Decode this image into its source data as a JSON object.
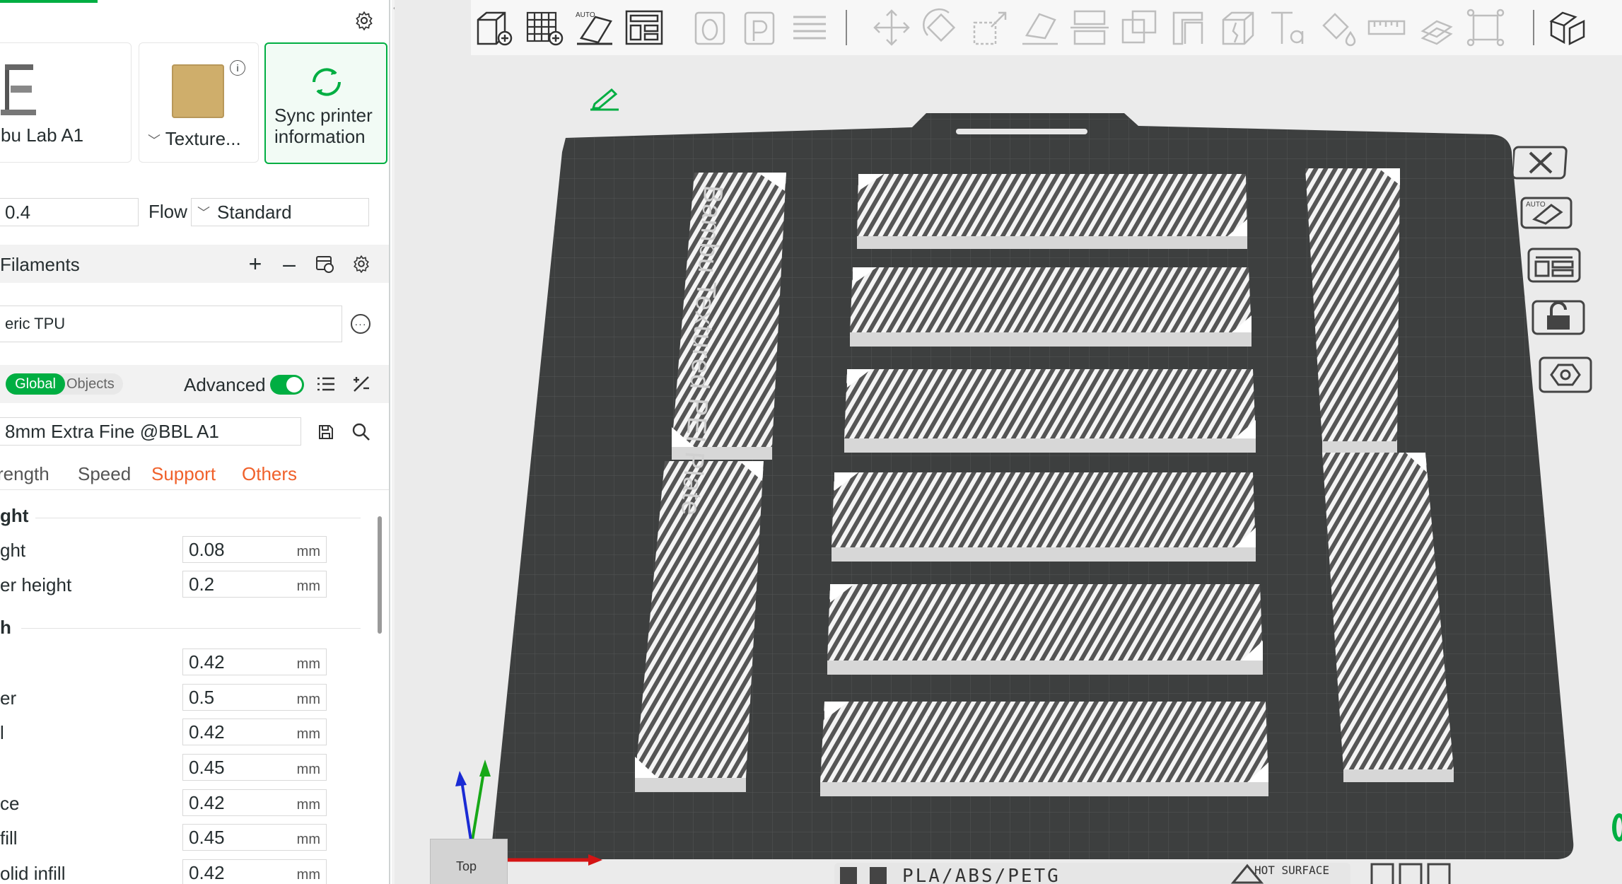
{
  "printer": {
    "name": "bu Lab A1"
  },
  "plate": {
    "name": "Texture..."
  },
  "sync": {
    "line1": "Sync printer",
    "line2": "information"
  },
  "nozzle": {
    "value": "0.4"
  },
  "flow": {
    "label": "Flow",
    "value": "Standard"
  },
  "filaments": {
    "title": "Filaments",
    "item": "eric TPU"
  },
  "process": {
    "toggle_global": "Global",
    "toggle_objects": "Objects",
    "advanced_label": "Advanced",
    "preset": "8mm Extra Fine @BBL A1"
  },
  "tabs": {
    "strength": "rength",
    "speed": "Speed",
    "support": "Support",
    "others": "Others"
  },
  "params": {
    "section1": "ght",
    "row1": {
      "label": "ght",
      "value": "0.08",
      "unit": "mm"
    },
    "row2": {
      "label": "er height",
      "value": "0.2",
      "unit": "mm"
    },
    "section2": "h",
    "row3": {
      "label": "",
      "value": "0.42",
      "unit": "mm"
    },
    "row4": {
      "label": "er",
      "value": "0.5",
      "unit": "mm"
    },
    "row5": {
      "label": "l",
      "value": "0.42",
      "unit": "mm"
    },
    "row6": {
      "label": "",
      "value": "0.45",
      "unit": "mm"
    },
    "row7": {
      "label": "ce",
      "value": "0.42",
      "unit": "mm"
    },
    "row8": {
      "label": "fill",
      "value": "0.45",
      "unit": "mm"
    },
    "row9": {
      "label": "olid infill",
      "value": "0.42",
      "unit": "mm"
    }
  },
  "viewport": {
    "plate_label": "Bambu Textured PEI Plate",
    "bed_bottom_text": "PLA/ABS/PETG",
    "hot_surface": "HOT SURFACE",
    "view_cube": "Top"
  },
  "colors": {
    "accent": "#00ae42",
    "orange": "#f0612b",
    "bed": "#3d3f3f",
    "model": "#e6e6e6"
  }
}
